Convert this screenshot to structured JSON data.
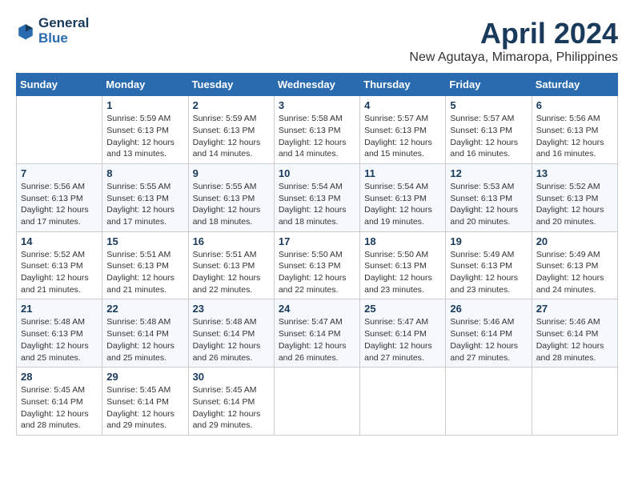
{
  "logo": {
    "line1": "General",
    "line2": "Blue"
  },
  "title": "April 2024",
  "location": "New Agutaya, Mimaropa, Philippines",
  "days_header": [
    "Sunday",
    "Monday",
    "Tuesday",
    "Wednesday",
    "Thursday",
    "Friday",
    "Saturday"
  ],
  "weeks": [
    [
      {
        "day": "",
        "info": ""
      },
      {
        "day": "1",
        "info": "Sunrise: 5:59 AM\nSunset: 6:13 PM\nDaylight: 12 hours\nand 13 minutes."
      },
      {
        "day": "2",
        "info": "Sunrise: 5:59 AM\nSunset: 6:13 PM\nDaylight: 12 hours\nand 14 minutes."
      },
      {
        "day": "3",
        "info": "Sunrise: 5:58 AM\nSunset: 6:13 PM\nDaylight: 12 hours\nand 14 minutes."
      },
      {
        "day": "4",
        "info": "Sunrise: 5:57 AM\nSunset: 6:13 PM\nDaylight: 12 hours\nand 15 minutes."
      },
      {
        "day": "5",
        "info": "Sunrise: 5:57 AM\nSunset: 6:13 PM\nDaylight: 12 hours\nand 16 minutes."
      },
      {
        "day": "6",
        "info": "Sunrise: 5:56 AM\nSunset: 6:13 PM\nDaylight: 12 hours\nand 16 minutes."
      }
    ],
    [
      {
        "day": "7",
        "info": "Sunrise: 5:56 AM\nSunset: 6:13 PM\nDaylight: 12 hours\nand 17 minutes."
      },
      {
        "day": "8",
        "info": "Sunrise: 5:55 AM\nSunset: 6:13 PM\nDaylight: 12 hours\nand 17 minutes."
      },
      {
        "day": "9",
        "info": "Sunrise: 5:55 AM\nSunset: 6:13 PM\nDaylight: 12 hours\nand 18 minutes."
      },
      {
        "day": "10",
        "info": "Sunrise: 5:54 AM\nSunset: 6:13 PM\nDaylight: 12 hours\nand 18 minutes."
      },
      {
        "day": "11",
        "info": "Sunrise: 5:54 AM\nSunset: 6:13 PM\nDaylight: 12 hours\nand 19 minutes."
      },
      {
        "day": "12",
        "info": "Sunrise: 5:53 AM\nSunset: 6:13 PM\nDaylight: 12 hours\nand 20 minutes."
      },
      {
        "day": "13",
        "info": "Sunrise: 5:52 AM\nSunset: 6:13 PM\nDaylight: 12 hours\nand 20 minutes."
      }
    ],
    [
      {
        "day": "14",
        "info": "Sunrise: 5:52 AM\nSunset: 6:13 PM\nDaylight: 12 hours\nand 21 minutes."
      },
      {
        "day": "15",
        "info": "Sunrise: 5:51 AM\nSunset: 6:13 PM\nDaylight: 12 hours\nand 21 minutes."
      },
      {
        "day": "16",
        "info": "Sunrise: 5:51 AM\nSunset: 6:13 PM\nDaylight: 12 hours\nand 22 minutes."
      },
      {
        "day": "17",
        "info": "Sunrise: 5:50 AM\nSunset: 6:13 PM\nDaylight: 12 hours\nand 22 minutes."
      },
      {
        "day": "18",
        "info": "Sunrise: 5:50 AM\nSunset: 6:13 PM\nDaylight: 12 hours\nand 23 minutes."
      },
      {
        "day": "19",
        "info": "Sunrise: 5:49 AM\nSunset: 6:13 PM\nDaylight: 12 hours\nand 23 minutes."
      },
      {
        "day": "20",
        "info": "Sunrise: 5:49 AM\nSunset: 6:13 PM\nDaylight: 12 hours\nand 24 minutes."
      }
    ],
    [
      {
        "day": "21",
        "info": "Sunrise: 5:48 AM\nSunset: 6:13 PM\nDaylight: 12 hours\nand 25 minutes."
      },
      {
        "day": "22",
        "info": "Sunrise: 5:48 AM\nSunset: 6:14 PM\nDaylight: 12 hours\nand 25 minutes."
      },
      {
        "day": "23",
        "info": "Sunrise: 5:48 AM\nSunset: 6:14 PM\nDaylight: 12 hours\nand 26 minutes."
      },
      {
        "day": "24",
        "info": "Sunrise: 5:47 AM\nSunset: 6:14 PM\nDaylight: 12 hours\nand 26 minutes."
      },
      {
        "day": "25",
        "info": "Sunrise: 5:47 AM\nSunset: 6:14 PM\nDaylight: 12 hours\nand 27 minutes."
      },
      {
        "day": "26",
        "info": "Sunrise: 5:46 AM\nSunset: 6:14 PM\nDaylight: 12 hours\nand 27 minutes."
      },
      {
        "day": "27",
        "info": "Sunrise: 5:46 AM\nSunset: 6:14 PM\nDaylight: 12 hours\nand 28 minutes."
      }
    ],
    [
      {
        "day": "28",
        "info": "Sunrise: 5:45 AM\nSunset: 6:14 PM\nDaylight: 12 hours\nand 28 minutes."
      },
      {
        "day": "29",
        "info": "Sunrise: 5:45 AM\nSunset: 6:14 PM\nDaylight: 12 hours\nand 29 minutes."
      },
      {
        "day": "30",
        "info": "Sunrise: 5:45 AM\nSunset: 6:14 PM\nDaylight: 12 hours\nand 29 minutes."
      },
      {
        "day": "",
        "info": ""
      },
      {
        "day": "",
        "info": ""
      },
      {
        "day": "",
        "info": ""
      },
      {
        "day": "",
        "info": ""
      }
    ]
  ]
}
